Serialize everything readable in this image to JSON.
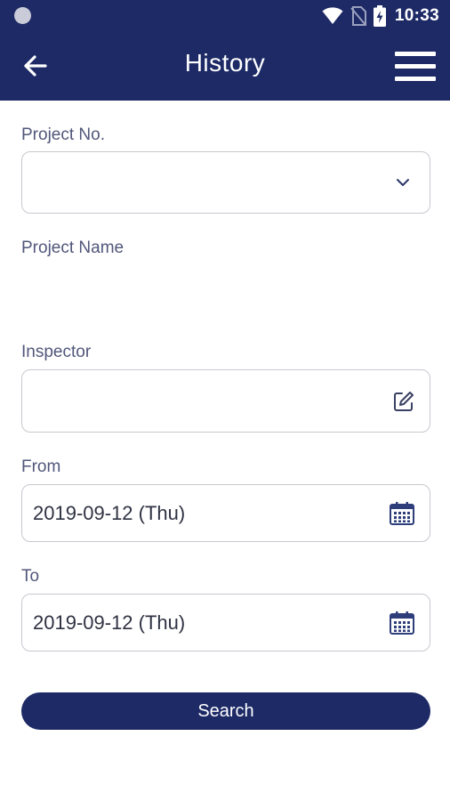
{
  "status_bar": {
    "time": "10:33",
    "icons": [
      "circle-notification-icon",
      "wifi-icon",
      "no-sim-icon",
      "battery-charging-icon"
    ]
  },
  "header": {
    "title": "History",
    "back_icon": "arrow-left-icon",
    "menu_icon": "hamburger-menu-icon"
  },
  "form": {
    "project_no": {
      "label": "Project No.",
      "value": "",
      "icon": "chevron-down-icon"
    },
    "project_name": {
      "label": "Project Name",
      "value": ""
    },
    "inspector": {
      "label": "Inspector",
      "value": "",
      "icon": "edit-icon"
    },
    "from": {
      "label": "From",
      "value": "2019-09-12 (Thu)",
      "icon": "calendar-icon"
    },
    "to": {
      "label": "To",
      "value": "2019-09-12 (Thu)",
      "icon": "calendar-icon"
    },
    "search_label": "Search"
  },
  "colors": {
    "primary": "#1d2a66",
    "label_text": "#51577a",
    "field_border": "#c7c9cf",
    "background": "#ffffff"
  }
}
